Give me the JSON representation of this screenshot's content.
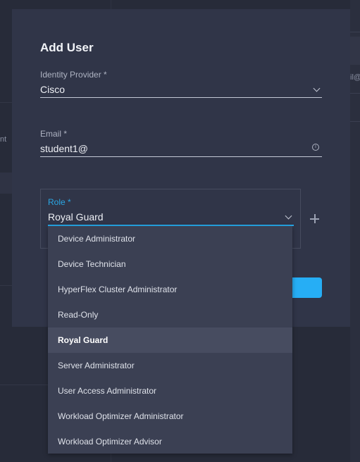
{
  "background": {
    "left_fragment": "nt",
    "right_fragment": "il@"
  },
  "modal": {
    "title": "Add User",
    "identity_provider": {
      "label": "Identity Provider *",
      "value": "Cisco"
    },
    "email": {
      "label": "Email *",
      "value": "student1@",
      "info_icon": "i"
    },
    "role": {
      "label": "Role *",
      "value": "Royal Guard",
      "options": [
        "Device Administrator",
        "Device Technician",
        "HyperFlex Cluster Administrator",
        "Read-Only",
        "Royal Guard",
        "Server Administrator",
        "User Access Administrator",
        "Workload Optimizer Administrator",
        "Workload Optimizer Advisor"
      ],
      "selected_index": 4
    },
    "primary_button_label": ""
  },
  "colors": {
    "accent": "#26aef5",
    "focus_underline": "#26a7e8",
    "modal_bg": "#303548",
    "dropdown_bg": "#3b4053",
    "selected_item_bg": "#474c60"
  }
}
